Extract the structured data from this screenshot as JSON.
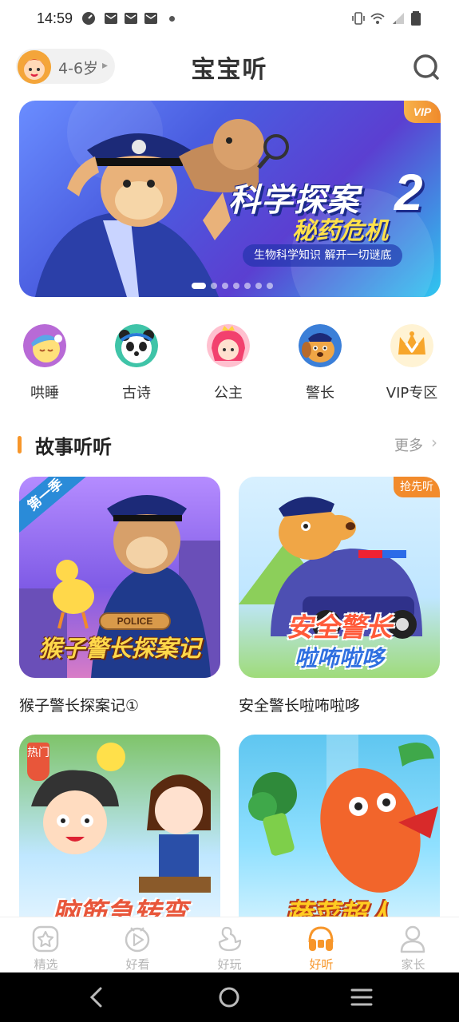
{
  "status_bar": {
    "time": "14:59",
    "left_icons": [
      "speed-icon",
      "mail-icon",
      "mail-icon",
      "mail-icon"
    ],
    "right_icons": [
      "vibrate-icon",
      "wifi-icon",
      "signal-icon",
      "battery-icon"
    ]
  },
  "header": {
    "age_label": "4-6岁",
    "title": "宝宝听",
    "search_icon": "search-icon"
  },
  "banner": {
    "vip_label": "VIP",
    "title": "科学探案",
    "number": "2",
    "subtitle": "秘药危机",
    "caption": "生物科学知识 解开一切谜底",
    "page_count": 7,
    "active_page": 1,
    "colors": {
      "bg_start": "#6a8dff",
      "bg_end": "#2fc7f0",
      "accent": "#ffe14a"
    }
  },
  "categories": [
    {
      "label": "哄睡",
      "icon": "sleep-icon",
      "color": "#c86fd8"
    },
    {
      "label": "古诗",
      "icon": "panda-icon",
      "color": "#3fc4a8"
    },
    {
      "label": "公主",
      "icon": "princess-icon",
      "color": "#f26b8f"
    },
    {
      "label": "警长",
      "icon": "police-dog-icon",
      "color": "#3b7fd8"
    },
    {
      "label": "VIP专区",
      "icon": "crown-icon",
      "color": "#f7b32b"
    }
  ],
  "section": {
    "title": "故事听听",
    "more_label": "更多",
    "accent": "#f7962a"
  },
  "cards": [
    {
      "title": "猴子警长探案记①",
      "corner_label": "第一季",
      "art_text": "猴子警长探案记",
      "art_sign": "POLICE"
    },
    {
      "title": "安全警长啦咘啦哆",
      "badge": "抢先听",
      "art_text_top": "安全警长",
      "art_text_bottom": "啦咘啦哆"
    },
    {
      "title": "",
      "hot_label": "热门",
      "art_text": "脑筋急转弯"
    },
    {
      "title": "",
      "art_text": "蔬菜超人"
    }
  ],
  "tabbar": {
    "tabs": [
      {
        "label": "精选",
        "icon": "star-box-icon",
        "active": false
      },
      {
        "label": "好看",
        "icon": "play-circle-icon",
        "active": false
      },
      {
        "label": "好玩",
        "icon": "duck-icon",
        "active": false
      },
      {
        "label": "好听",
        "icon": "headphones-icon",
        "active": true
      },
      {
        "label": "家长",
        "icon": "parent-icon",
        "active": false
      }
    ],
    "active_color": "#f7962a",
    "inactive_color": "#b5b5b5"
  },
  "system_nav": [
    "back-icon",
    "home-icon",
    "recents-icon"
  ]
}
